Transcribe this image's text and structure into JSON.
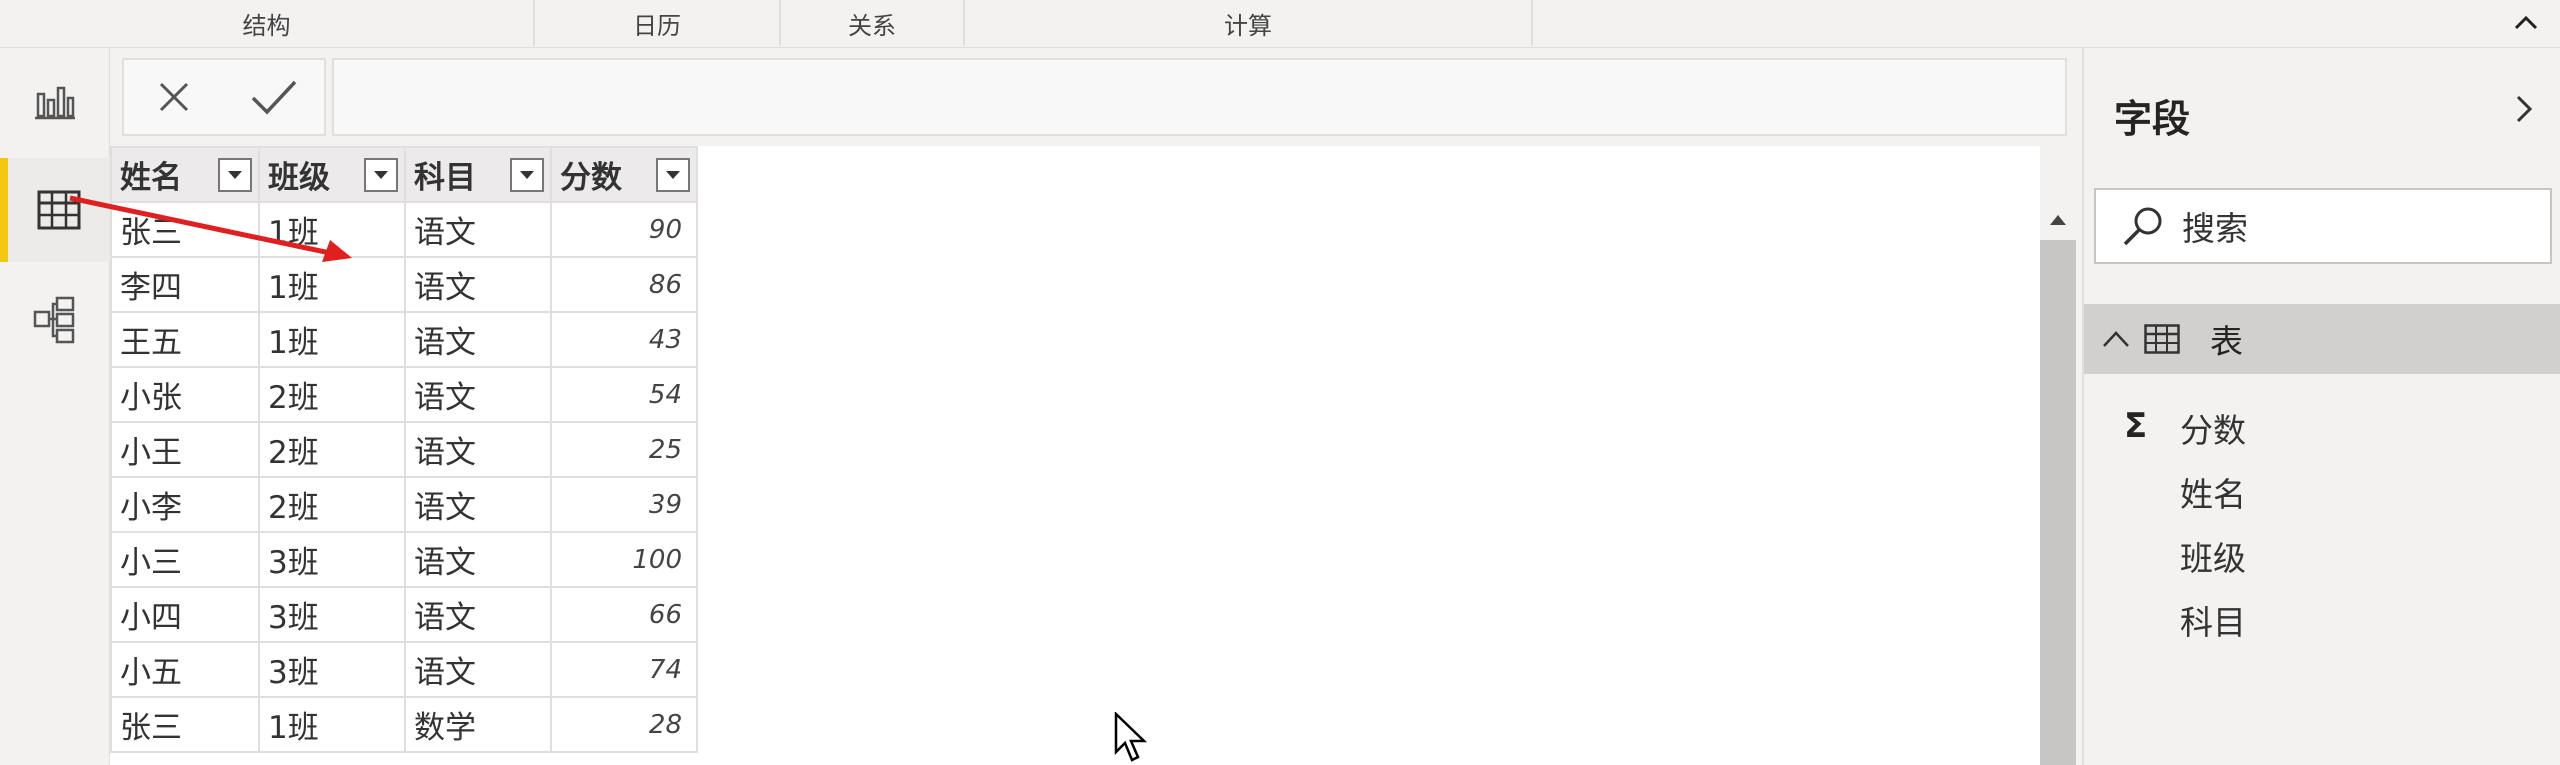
{
  "ribbon": {
    "groups": [
      "结构",
      "日历",
      "关系",
      "计算"
    ]
  },
  "leftnav": {
    "items": [
      {
        "name": "report-view",
        "icon": "bar-chart-icon"
      },
      {
        "name": "data-view",
        "icon": "table-icon",
        "active": true
      },
      {
        "name": "model-view",
        "icon": "model-icon"
      }
    ]
  },
  "formula_bar": {
    "cancel_icon": "close-icon",
    "commit_icon": "check-icon",
    "value": ""
  },
  "table": {
    "columns": [
      "姓名",
      "班级",
      "科目",
      "分数"
    ],
    "rows": [
      [
        "张三",
        "1班",
        "语文",
        "90"
      ],
      [
        "李四",
        "1班",
        "语文",
        "86"
      ],
      [
        "王五",
        "1班",
        "语文",
        "43"
      ],
      [
        "小张",
        "2班",
        "语文",
        "54"
      ],
      [
        "小王",
        "2班",
        "语文",
        "25"
      ],
      [
        "小李",
        "2班",
        "语文",
        "39"
      ],
      [
        "小三",
        "3班",
        "语文",
        "100"
      ],
      [
        "小四",
        "3班",
        "语文",
        "66"
      ],
      [
        "小五",
        "3班",
        "语文",
        "74"
      ],
      [
        "张三",
        "1班",
        "数学",
        "28"
      ]
    ]
  },
  "fields_panel": {
    "title": "字段",
    "search_placeholder": "搜索",
    "table_name": "表",
    "fields": [
      "分数",
      "姓名",
      "班级",
      "科目"
    ]
  },
  "colors": {
    "accent": "#f2c811",
    "annotation_arrow": "#e02020"
  }
}
